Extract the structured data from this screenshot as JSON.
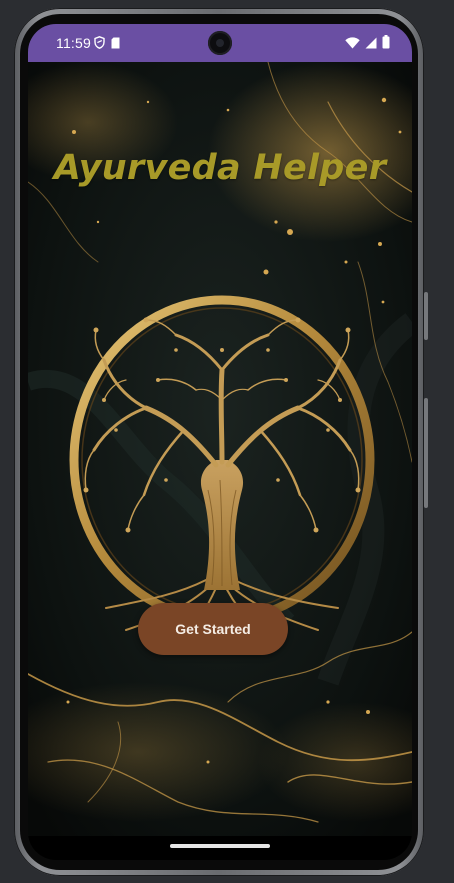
{
  "status_bar": {
    "time": "11:59",
    "background_color": "#6a4fa3",
    "left_icons": [
      "shield-icon",
      "sim-card-icon"
    ],
    "right_icons": [
      "wifi-icon",
      "cell-signal-icon",
      "battery-icon"
    ]
  },
  "app": {
    "title": "Ayurveda Helper",
    "title_color": "#a89a28",
    "background_image": "dark-marble-gold-veins",
    "emblem": "tree-of-life-icon",
    "primary_button": {
      "label": "Get Started",
      "color": "#7a4526"
    }
  },
  "navigation": {
    "home_indicator": "gesture-bar"
  }
}
